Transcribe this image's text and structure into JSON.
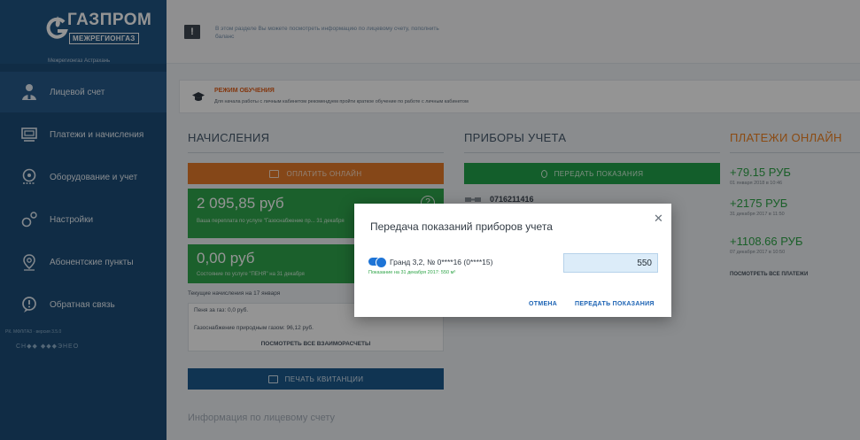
{
  "brand": {
    "name": "ГАЗПРОМ",
    "sub": "МЕЖРЕГИОНГАЗ",
    "region": "Межрегионгаз Астрахань"
  },
  "sidebar": {
    "items": [
      {
        "label": "Лицевой счет",
        "icon": "person-icon"
      },
      {
        "label": "Платежи и начисления",
        "icon": "payments-icon"
      },
      {
        "label": "Оборудование и учет",
        "icon": "meter-icon"
      },
      {
        "label": "Настройки",
        "icon": "settings-icon"
      },
      {
        "label": "Абонентские пункты",
        "icon": "location-pin-icon"
      },
      {
        "label": "Обратная связь",
        "icon": "feedback-icon"
      }
    ],
    "version": "РК. МФЛ/ГАЗ · версия 3.5.0",
    "developer": "СН◆◆ ◆◆◆ЭНЕО"
  },
  "topbar": {
    "info_text": "В этом разделе Вы можете посмотреть информацию по лицевому счету, пополнить баланс"
  },
  "study_banner": {
    "title": "РЕЖИМ ОБУЧЕНИЯ",
    "text": "Для начала работы с личным кабинетом рекомендуем пройти краткое обучение по работе с личным кабинетом"
  },
  "accruals": {
    "title": "НАЧИСЛЕНИЯ",
    "pay_button": "ОПЛАТИТЬ ОНЛАЙН",
    "cards": [
      {
        "amount": "2 095,85 руб",
        "desc": "Ваша переплата по услуге \"Газоснабжение пр... 31 декабря"
      },
      {
        "amount": "0,00 руб",
        "desc": "Состояние по услуге \"ПЕНЯ\" на 31 декабря"
      }
    ],
    "current_title": "Текущие начисления на 17 января",
    "penalty_line": "Пеня за газ: 0,0 руб.",
    "gas_line": "Газоснабжение природным газом: 96,12 руб.",
    "all_settlements": "ПОСМОТРЕТЬ ВСЕ ВЗАИМОРАСЧЕТЫ",
    "print_button": "ПЕЧАТЬ КВИТАНЦИИ"
  },
  "meters": {
    "title": "ПРИБОРЫ УЧЕТА",
    "submit_button": "ПЕРЕДАТЬ ПОКАЗАНИЯ",
    "meter_number": "0716211416"
  },
  "payments": {
    "title": "ПЛАТЕЖИ ОНЛАЙН",
    "items": [
      {
        "sum": "+79.15 РУБ",
        "date": "01 января 2018 в 10:46"
      },
      {
        "sum": "+2175 РУБ",
        "date": "31 декабря 2017 в 11:50"
      },
      {
        "sum": "+1108.66 РУБ",
        "date": "07 декабря 2017 в 10:50"
      }
    ],
    "all_link": "ПОСМОТРЕТЬ ВСЕ ПЛАТЕЖИ"
  },
  "account_info_title": "Информация по лицевому счету",
  "modal": {
    "title": "Передача показаний приборов учета",
    "meter_label": "Гранд 3,2, № 0****16 (0****15)",
    "last_reading": "Показание на 31 декабря 2017: 550 м³",
    "reading_value": "550",
    "cancel": "ОТМЕНА",
    "submit": "ПЕРЕДАТЬ ПОКАЗАНИЯ"
  },
  "colors": {
    "sidebar": "#1c4d77",
    "accent_orange": "#e57b2a",
    "accent_green": "#2fa54c",
    "accent_blue": "#1c5a8e",
    "link_blue": "#1c63b4"
  }
}
